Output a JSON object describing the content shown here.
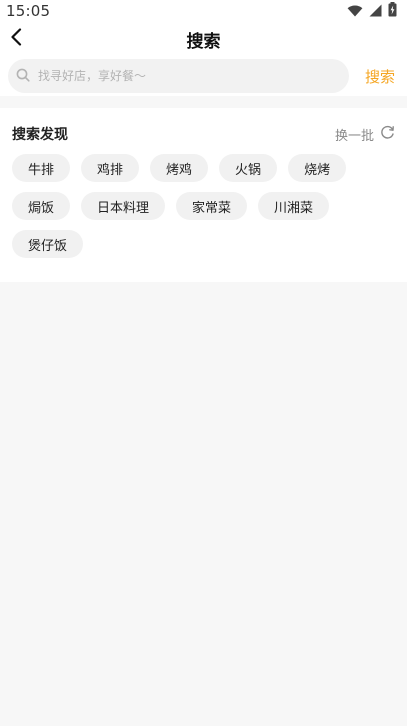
{
  "status": {
    "time": "15:05",
    "icons": [
      "wifi-icon",
      "signal-icon",
      "battery-icon"
    ]
  },
  "header": {
    "title": "搜索",
    "back_icon": "chevron-left-icon"
  },
  "search": {
    "placeholder": "找寻好店，享好餐～",
    "value": "",
    "button_label": "搜索",
    "accent_color": "#f5a623"
  },
  "discover": {
    "title": "搜索发现",
    "refresh_label": "换一批",
    "refresh_icon": "refresh-icon",
    "tags": [
      "牛排",
      "鸡排",
      "烤鸡",
      "火锅",
      "烧烤",
      "焗饭",
      "日本料理",
      "家常菜",
      "川湘菜",
      "煲仔饭"
    ]
  }
}
